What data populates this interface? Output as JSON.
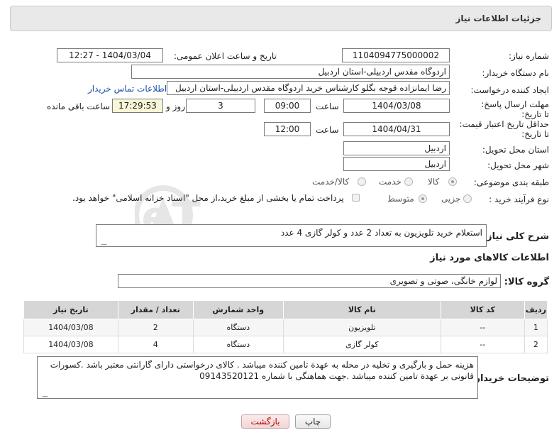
{
  "header": {
    "title": "جزئیات اطلاعات نیاز"
  },
  "fields": {
    "need_number_label": "شماره نیاز:",
    "need_number": "1104094775000002",
    "announce_label": "تاریخ و ساعت اعلان عمومی:",
    "announce_value": "1404/03/04 - 12:27",
    "buyer_org_label": "نام دستگاه خریدار:",
    "buyer_org": "اردوگاه مقدس اردبیلی-استان اردبیل",
    "creator_label": "ایجاد کننده درخواست:",
    "creator": "رضا ایمانزاده قوجه بگلو کارشناس خرید اردوگاه مقدس اردبیلی-استان اردبیل",
    "contact_link": "اطلاعات تماس خریدار",
    "deadline_label": "مهلت ارسال پاسخ: تا تاریخ:",
    "deadline_date": "1404/03/08",
    "time_label": "ساعت",
    "deadline_time": "09:00",
    "days": "3",
    "days_label": "روز و",
    "remaining": "17:29:53",
    "remaining_label": "ساعت باقی مانده",
    "validity_label": "حداقل تاریخ اعتبار قیمت: تا تاریخ:",
    "validity_date": "1404/04/31",
    "validity_time": "12:00",
    "province_label": "استان محل تحویل:",
    "province": "اردبیل",
    "city_label": "شهر محل تحویل:",
    "city": "اردبیل",
    "category_label": "طبقه بندی موضوعی:",
    "category_options": [
      "کالا",
      "خدمت",
      "کالا/خدمت"
    ],
    "process_label": "نوع فرآیند خرید :",
    "process_options": [
      "جزیی",
      "متوسط"
    ],
    "payment_note": "پرداخت تمام یا بخشی از مبلغ خرید،از محل \"اسناد خزانه اسلامی\" خواهد بود.",
    "description_label": "شرح کلی نیاز:",
    "description": "استعلام خرید تلویزیون به تعداد 2 عدد و کولر گازی 4 عدد",
    "goods_info_title": "اطلاعات کالاهای مورد نیاز",
    "goods_group_label": "گروه کالا:",
    "goods_group": "لوازم خانگی، صوتی و تصویری"
  },
  "table": {
    "headers": [
      "ردیف",
      "کد کالا",
      "نام کالا",
      "واحد شمارش",
      "تعداد / مقدار",
      "تاریخ نیاز"
    ],
    "rows": [
      [
        "1",
        "--",
        "تلویزیون",
        "دستگاه",
        "2",
        "1404/03/08"
      ],
      [
        "2",
        "--",
        "کولر گازی",
        "دستگاه",
        "4",
        "1404/03/08"
      ]
    ]
  },
  "buyer_notes_label": "توضیحات خریدار:",
  "buyer_notes": "هزینه حمل و بارگیری و تخلیه در محله به عهدة تامین کننده میباشد . کالای درخواستی دارای گارانتی معتبر باشد .کسورات قانونی بر عهدة تامین کننده میباشد .جهت هماهنگی با شماره 09143520121",
  "buttons": {
    "print": "چاپ",
    "back": "بازگشت"
  },
  "watermark": "AriaTender.neT",
  "colors": {
    "link": "#1a4fa8",
    "panel": "#e9e9e9",
    "table_header": "#d6d6d6"
  }
}
